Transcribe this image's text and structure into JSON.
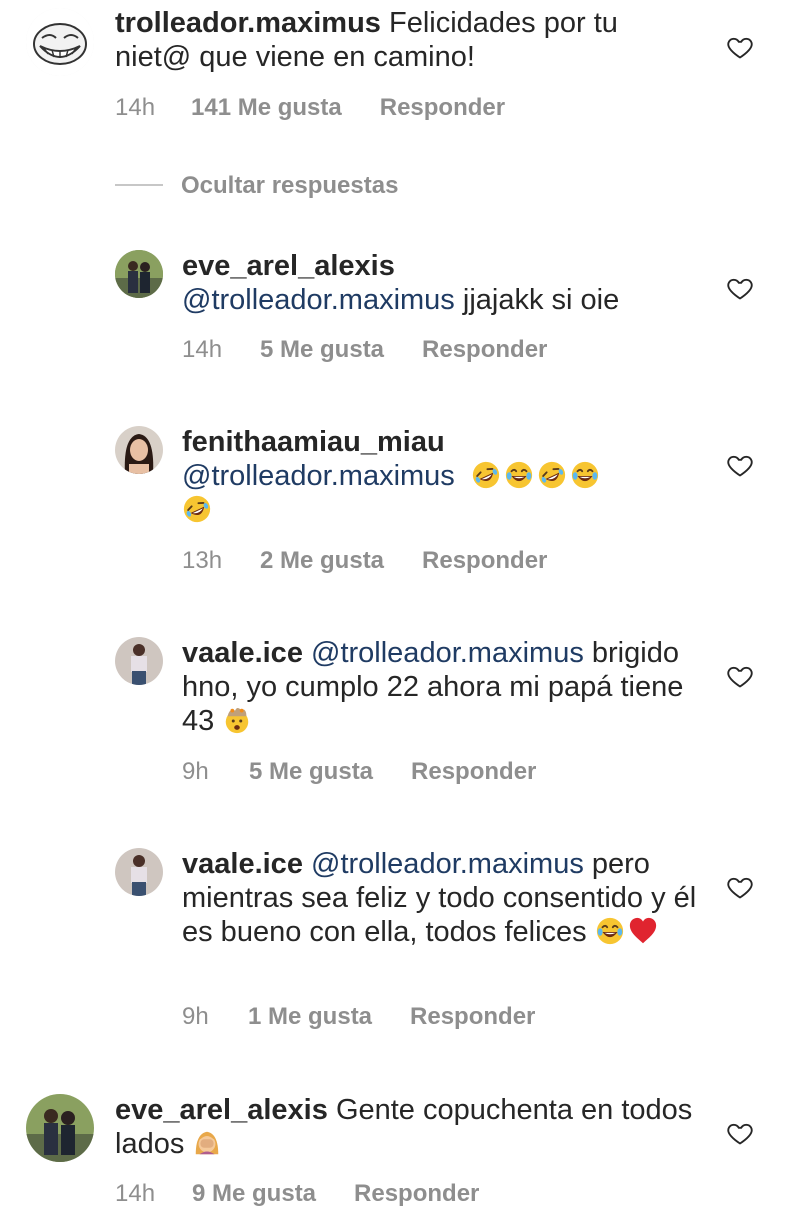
{
  "comments": [
    {
      "username": "trolleador.maximus",
      "text": "Felicidades por tu niet@ que viene en camino!",
      "time": "14h",
      "likes": "141 Me gusta",
      "reply": "Responder",
      "avatar_icon": "troll-face-avatar"
    },
    {
      "username": "eve_arel_alexis",
      "mention": "@trolleador.maximus",
      "text": "jjajakk si oie",
      "time": "14h",
      "likes": "5 Me gusta",
      "reply": "Responder",
      "avatar_icon": "couple-photo-avatar"
    },
    {
      "username": "fenithaamiau_miau",
      "mention": "@trolleador.maximus",
      "emojis": [
        "rofl-emoji",
        "tears-of-joy-emoji",
        "rofl-emoji",
        "tears-of-joy-emoji",
        "rofl-emoji"
      ],
      "time": "13h",
      "likes": "2 Me gusta",
      "reply": "Responder",
      "avatar_icon": "woman-photo-avatar"
    },
    {
      "username": "vaale.ice",
      "mention": "@trolleador.maximus",
      "text": "brigido hno, yo cumplo 22 ahora mi papá tiene 43",
      "emoji": "exploding-head-emoji",
      "time": "9h",
      "likes": "5 Me gusta",
      "reply": "Responder",
      "avatar_icon": "woman-photo-avatar"
    },
    {
      "username": "vaale.ice",
      "mention": "@trolleador.maximus",
      "text": "pero mientras sea feliz y todo consentido y él es bueno con ella, todos felices",
      "emojis": [
        "tears-of-joy-emoji",
        "red-heart-emoji"
      ],
      "time": "9h",
      "likes": "1 Me gusta",
      "reply": "Responder",
      "avatar_icon": "woman-photo-avatar"
    },
    {
      "username": "eve_arel_alexis",
      "text": "Gente copuchenta en todos lados",
      "emoji": "facepalm-emoji",
      "time": "14h",
      "likes": "9 Me gusta",
      "reply": "Responder",
      "avatar_icon": "couple-photo-avatar"
    }
  ],
  "hide_replies": "Ocultar respuestas",
  "colors": {
    "text": "#262626",
    "meta": "#8e8e8e",
    "mention": "#1f3b63",
    "heart_stroke": "#262626"
  }
}
